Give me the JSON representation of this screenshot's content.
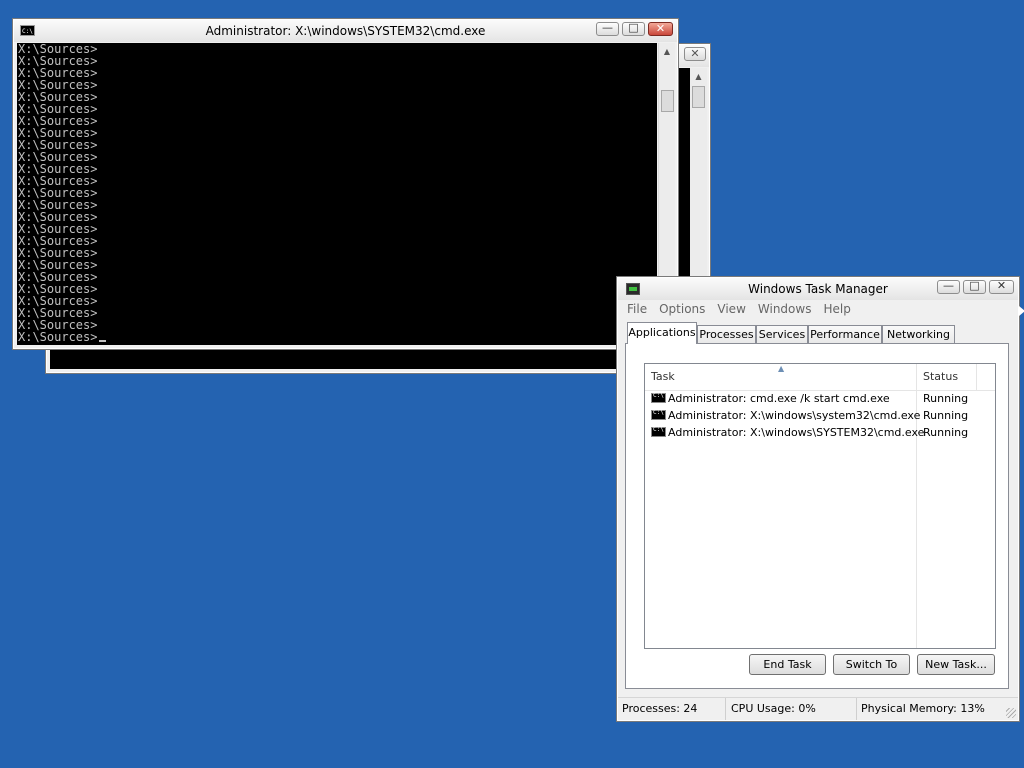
{
  "cmd_back_window": {
    "close_glyph": "✕"
  },
  "cmd_front_window": {
    "icon_text": "C:\\",
    "title": "Administrator: X:\\windows\\SYSTEM32\\cmd.exe",
    "minimize_glyph": "—",
    "maximize_glyph": "□",
    "close_glyph": "✕",
    "console_lines": [
      "X:\\Sources>",
      "X:\\Sources>",
      "X:\\Sources>",
      "X:\\Sources>",
      "X:\\Sources>",
      "X:\\Sources>",
      "X:\\Sources>",
      "X:\\Sources>",
      "X:\\Sources>",
      "X:\\Sources>",
      "X:\\Sources>",
      "X:\\Sources>",
      "X:\\Sources>",
      "X:\\Sources>",
      "X:\\Sources>",
      "X:\\Sources>",
      "X:\\Sources>",
      "X:\\Sources>",
      "X:\\Sources>",
      "X:\\Sources>",
      "X:\\Sources>",
      "X:\\Sources>",
      "X:\\Sources>",
      "X:\\Sources>",
      "X:\\Sources>"
    ]
  },
  "task_manager": {
    "title": "Windows Task Manager",
    "minimize_glyph": "—",
    "maximize_glyph": "□",
    "close_glyph": "✕",
    "menu": [
      "File",
      "Options",
      "View",
      "Windows",
      "Help"
    ],
    "tabs": [
      "Applications",
      "Processes",
      "Services",
      "Performance",
      "Networking"
    ],
    "active_tab": "Applications",
    "columns": {
      "task": "Task",
      "status": "Status"
    },
    "rows": [
      {
        "task": "Administrator: cmd.exe /k start cmd.exe",
        "status": "Running"
      },
      {
        "task": "Administrator: X:\\windows\\system32\\cmd.exe",
        "status": "Running"
      },
      {
        "task": "Administrator: X:\\windows\\SYSTEM32\\cmd.exe",
        "status": "Running"
      }
    ],
    "buttons": {
      "end_task": "End Task",
      "switch_to": "Switch To",
      "new_task": "New Task..."
    },
    "statusbar": {
      "processes": "Processes: 24",
      "cpu": "CPU Usage: 0%",
      "memory": "Physical Memory: 13%"
    }
  },
  "colors": {
    "desktop": "#2463b1",
    "console_bg": "#000000",
    "console_text": "#c0c0c0"
  }
}
